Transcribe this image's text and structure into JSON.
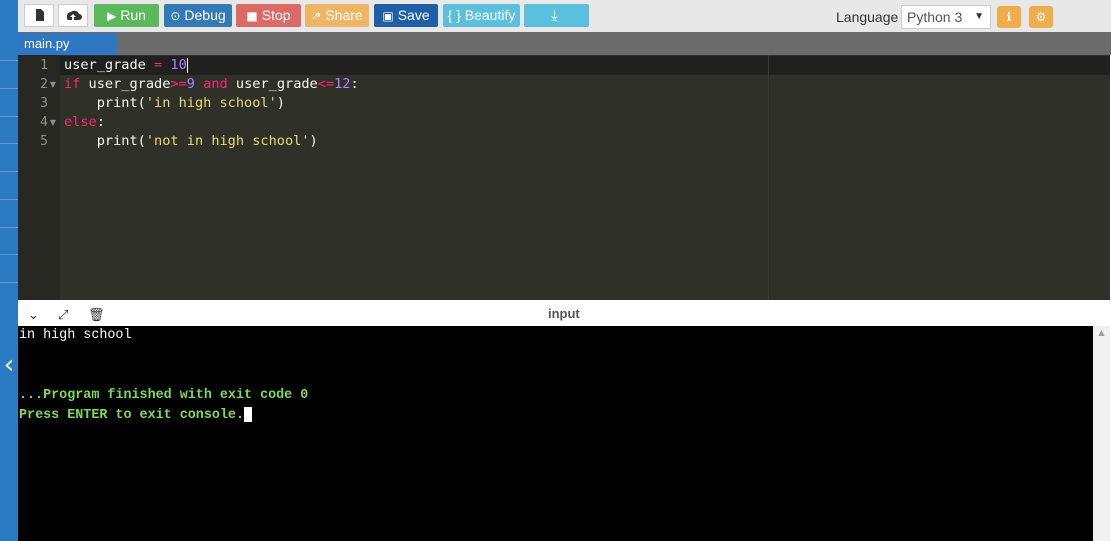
{
  "toolbar": {
    "run_label": "Run",
    "debug_label": "Debug",
    "stop_label": "Stop",
    "share_label": "Share",
    "save_label": "Save",
    "beautify_label": "{ } Beautify",
    "language_label": "Language",
    "language_value": "Python 3"
  },
  "tabs": [
    {
      "label": "main.py"
    }
  ],
  "editor": {
    "line_numbers": [
      "1",
      "2",
      "3",
      "4",
      "5"
    ]
  },
  "console": {
    "header_label": "input",
    "lines": [
      "in high school",
      "",
      "",
      "...Program finished with exit code 0",
      "Press ENTER to exit console."
    ]
  },
  "colors": {
    "toolbar_bg": "#e8e8e8",
    "run": "#5cb85c",
    "debug": "#337ab7",
    "stop": "#d9534f",
    "share": "#f0ad4e",
    "save": "#1f5fa8",
    "beautify": "#5bc0de",
    "download": "#5bc0de",
    "editor_bg": "#2f3129",
    "console_bg": "#000000",
    "console_green": "#7ed957"
  }
}
